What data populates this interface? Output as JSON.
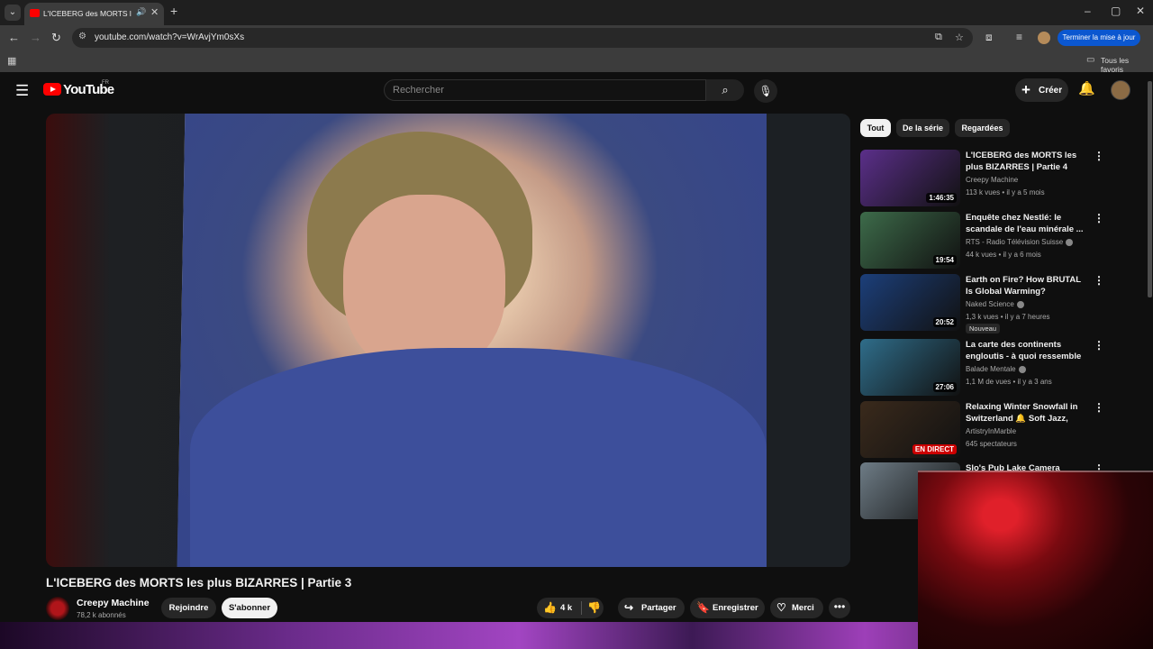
{
  "browser": {
    "tab_title": "L'ICEBERG des MORTS les p",
    "tab_audio_icon": "speaker-icon",
    "new_tab_symbol": "+",
    "url": "youtube.com/watch?v=WrAvjYm0sXs",
    "update_button": "Terminer la mise à jour",
    "bookmarks_folder": "Tous les favoris",
    "window_controls": [
      "–",
      "▢",
      "✕"
    ]
  },
  "youtube": {
    "region": "FR",
    "wordmark": "YouTube",
    "search_placeholder": "Rechercher",
    "create_label": "Créer"
  },
  "video": {
    "title": "L'ICEBERG des MORTS les plus BIZARRES | Partie 3",
    "channel": "Creepy Machine",
    "subscribers": "78,2 k abonnés",
    "join_label": "Rejoindre",
    "subscribe_label": "S'abonner",
    "likes": "4 k",
    "share_label": "Partager",
    "save_label": "Enregistrer",
    "thanks_label": "Merci"
  },
  "chips": [
    "Tout",
    "De la série",
    "Regardées"
  ],
  "recommendations": [
    {
      "title": "L'ICEBERG des MORTS les plus BIZARRES | Partie 4",
      "channel": "Creepy Machine",
      "meta": "113 k vues • il y a 5 mois",
      "duration": "1:46:35",
      "thumb_color": "#5b2f8a"
    },
    {
      "title": "Enquête chez Nestlé: le scandale de l'eau minérale ...",
      "channel": "RTS - Radio Télévision Suisse",
      "verified": true,
      "meta": "44 k vues • il y a 6 mois",
      "duration": "19:54",
      "thumb_color": "#3d6b4a"
    },
    {
      "title": "Earth on Fire? How BRUTAL Is Global Warming?",
      "channel": "Naked Science",
      "verified": true,
      "meta": "1,3 k vues • il y a 7 heures",
      "badge": "Nouveau",
      "duration": "20:52",
      "thumb_color": "#1c3f7a"
    },
    {
      "title": "La carte des continents engloutis - à quoi ressemble la...",
      "channel": "Balade Mentale",
      "verified": true,
      "meta": "1,1 M de vues • il y a 3 ans",
      "duration": "27:06",
      "thumb_color": "#2f6d8a"
    },
    {
      "title": "Relaxing Winter Snowfall in Switzerland 🔔 Soft Jazz, Coz...",
      "channel": "ArtistryInMarble",
      "meta": "645 spectateurs",
      "live": "EN DIRECT",
      "thumb_color": "#3a2a1c"
    },
    {
      "title": "Slo's Pub Lake Camera",
      "channel": "",
      "meta": "",
      "thumb_color": "#6e7c86"
    }
  ]
}
